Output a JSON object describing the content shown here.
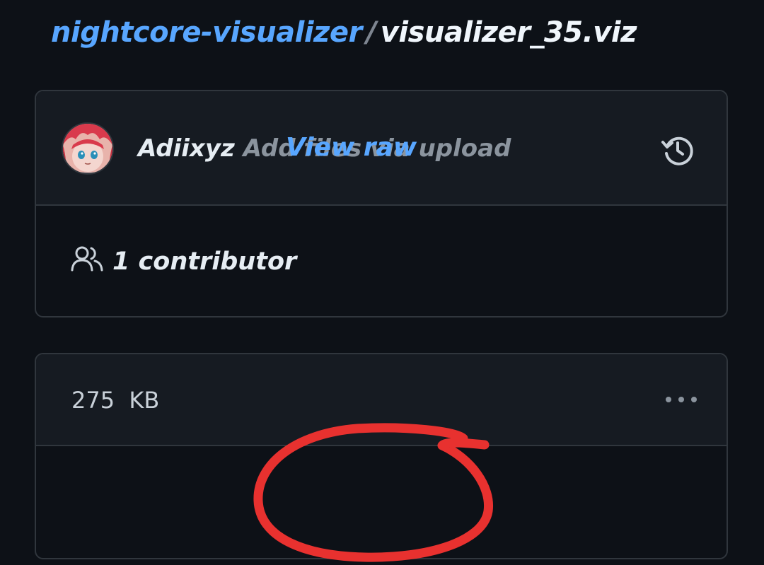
{
  "breadcrumb": {
    "repo": "nightcore-visualizer",
    "separator": "/",
    "file": "visualizer_35.viz"
  },
  "commit": {
    "author": "Adiixyz",
    "message": "Add files via upload",
    "avatar_icon": "user-avatar",
    "history_icon": "history-icon"
  },
  "contributors": {
    "icon": "people-icon",
    "label": "1 contributor"
  },
  "file_info": {
    "size": "275  KB",
    "more_icon": "kebab-horizontal-icon",
    "view_raw_label": "View raw"
  },
  "annotation": {
    "color": "#e8312f",
    "shape": "hand-drawn circle around View raw"
  },
  "colors": {
    "background": "#0d1117",
    "surface": "#161b22",
    "border": "#30363d",
    "link": "#58a6ff",
    "text": "#e6edf3",
    "muted": "#8b949e"
  }
}
